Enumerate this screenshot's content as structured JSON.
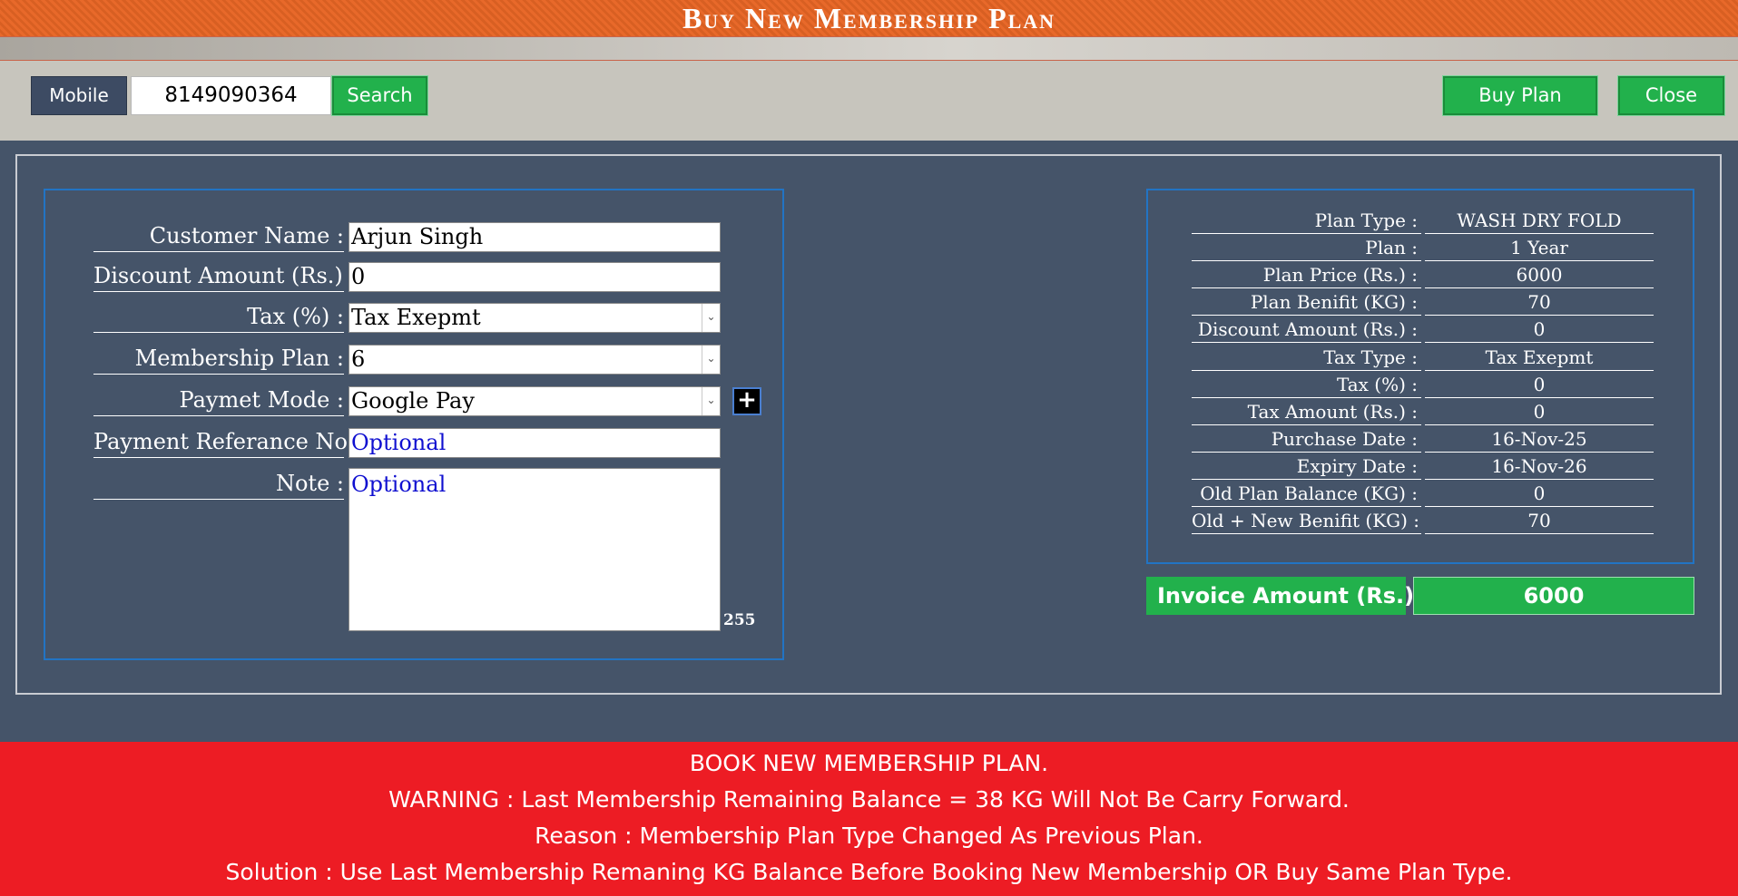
{
  "window": {
    "title": "Buy New Membership Plan"
  },
  "toolbar": {
    "mobile_label": "Mobile",
    "mobile_value": "8149090364",
    "search_label": "Search",
    "buy_label": "Buy Plan",
    "close_label": "Close"
  },
  "form": {
    "customer_name": {
      "label": "Customer Name :",
      "value": "Arjun Singh"
    },
    "discount": {
      "label": "Discount Amount (Rs.) :",
      "value": "0"
    },
    "tax": {
      "label": "Tax (%) :",
      "value": "Tax Exepmt"
    },
    "membership_plan": {
      "label": "Membership Plan :",
      "value": "6"
    },
    "payment_mode": {
      "label": "Paymet Mode :",
      "value": "Google Pay"
    },
    "payment_ref": {
      "label": "Payment Referance No :",
      "value": "Optional"
    },
    "note": {
      "label": "Note :",
      "value": "Optional"
    },
    "note_char_count": "255"
  },
  "summary": {
    "rows": [
      {
        "label": "Plan Type :",
        "value": "WASH DRY FOLD"
      },
      {
        "label": "Plan :",
        "value": "1 Year"
      },
      {
        "label": "Plan Price (Rs.) :",
        "value": "6000"
      },
      {
        "label": "Plan Benifit (KG) :",
        "value": "70"
      },
      {
        "label": "Discount Amount (Rs.) :",
        "value": "0"
      },
      {
        "label": "Tax Type :",
        "value": "Tax Exepmt"
      },
      {
        "label": "Tax (%) :",
        "value": "0"
      },
      {
        "label": "Tax Amount (Rs.) :",
        "value": "0"
      },
      {
        "label": "Purchase Date :",
        "value": "16-Nov-25"
      },
      {
        "label": "Expiry Date :",
        "value": "16-Nov-26"
      },
      {
        "label": "Old Plan Balance (KG) :",
        "value": "0"
      },
      {
        "label": "Old + New Benifit  (KG) :",
        "value": "70"
      }
    ],
    "invoice_label": "Invoice Amount (Rs.) :",
    "invoice_value": "6000"
  },
  "warning": {
    "line1": "BOOK NEW MEMBERSHIP PLAN.",
    "line2": "WARNING : Last Membership Remaining Balance = 38 KG Will Not Be Carry Forward.",
    "line3": "Reason : Membership Plan Type Changed As Previous Plan.",
    "line4": "Solution : Use Last Membership Remaning KG Balance Before Booking New Membership OR Buy Same Plan Type."
  },
  "colors": {
    "title_orange": "#e8692a",
    "panel_bg": "#455469",
    "button_green": "#22b14c",
    "warning_red": "#ed1c24",
    "panel_border_blue": "#2274c4",
    "optional_text_blue": "#1010d0"
  },
  "icons": {
    "add_payment_mode": "plus-icon",
    "dropdown": "chevron-down-icon"
  }
}
